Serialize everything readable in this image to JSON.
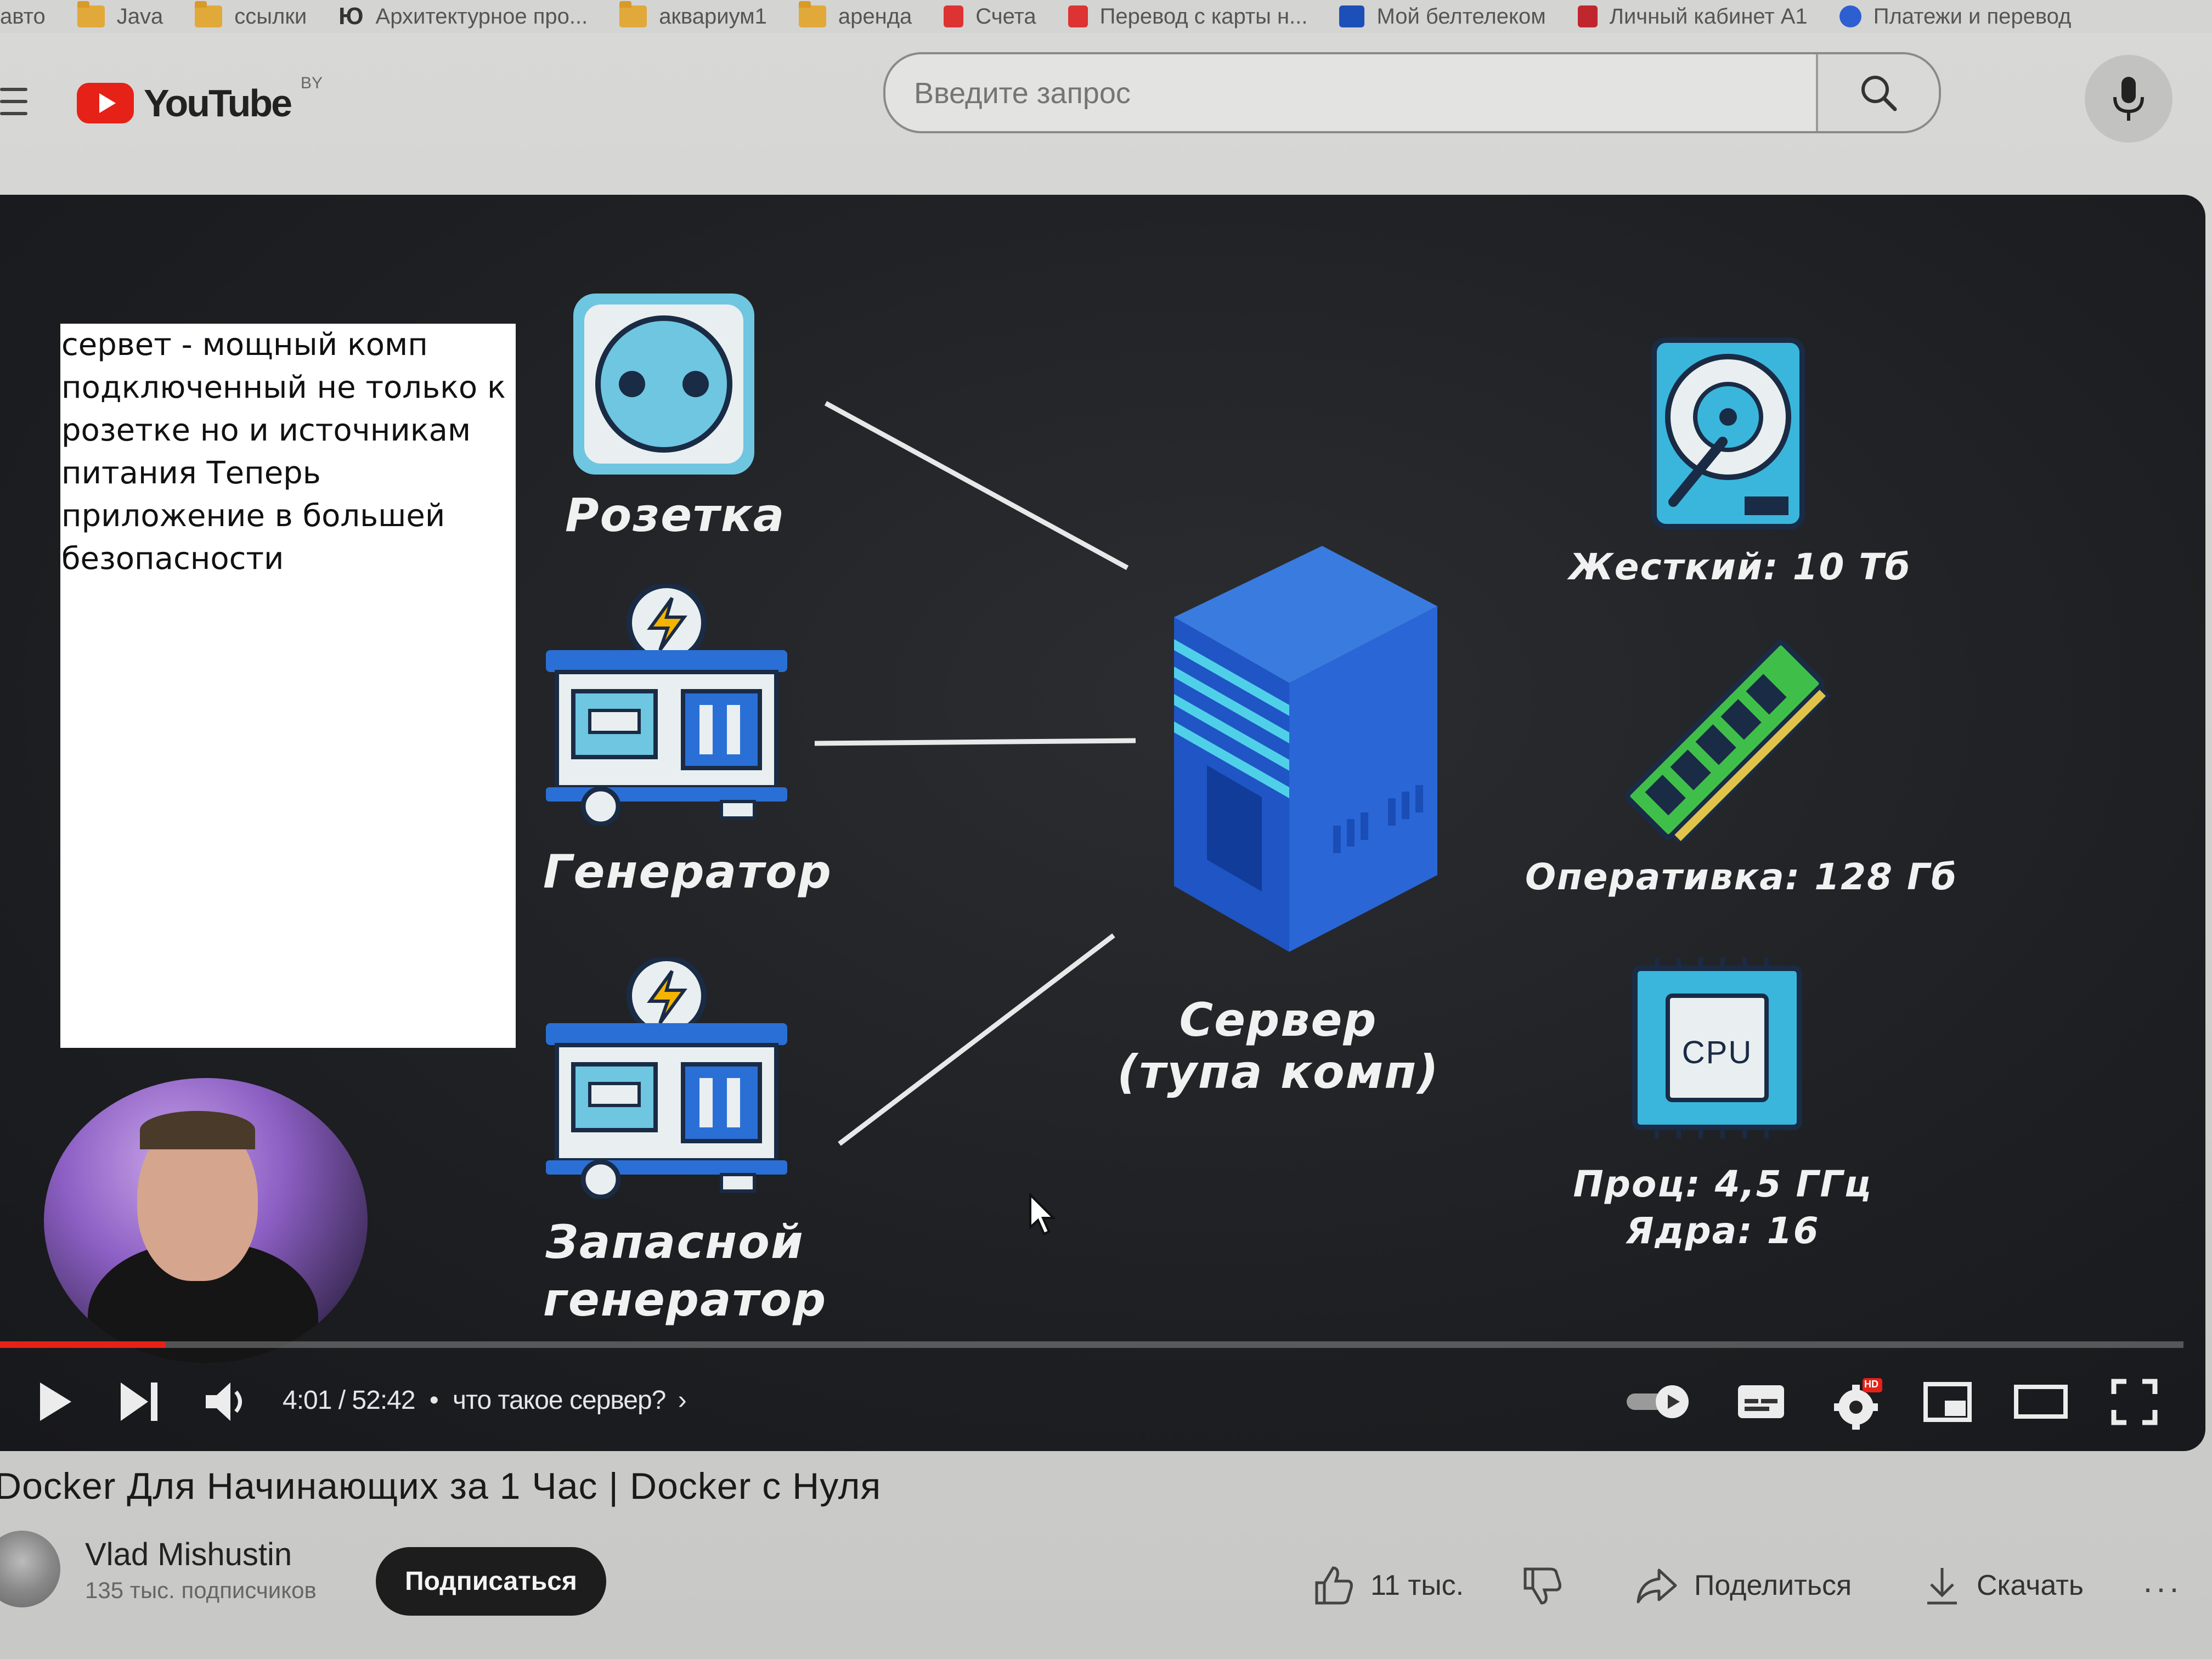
{
  "bookmarks": [
    {
      "label": "авто",
      "icon": "none"
    },
    {
      "label": "Java",
      "icon": "folder-icon"
    },
    {
      "label": "ссылки",
      "icon": "folder-icon"
    },
    {
      "label": "Архитектурное про...",
      "icon": "ю-badge-icon"
    },
    {
      "label": "аквариум1",
      "icon": "folder-icon"
    },
    {
      "label": "аренда",
      "icon": "folder-icon"
    },
    {
      "label": "Счета",
      "icon": "pdf-icon"
    },
    {
      "label": "Перевод с карты н...",
      "icon": "pdf-icon"
    },
    {
      "label": "Мой белтелеком",
      "icon": "beltelecom-icon"
    },
    {
      "label": "Личный кабинет A1",
      "icon": "a1-icon"
    },
    {
      "label": "Платежи и перевод",
      "icon": "payments-icon"
    }
  ],
  "header": {
    "logo_text": "YouTube",
    "logo_region": "BY",
    "search_placeholder": "Введите запрос"
  },
  "video": {
    "note_text": "сервет - мощный комп подключенный не только к розетке но и источникам питания Теперь приложение в большей безопасности",
    "diagram": {
      "socket_label": "Розетка",
      "generator_label": "Генератор",
      "backup_generator_label_line1": "Запасной",
      "backup_generator_label_line2": "генератор",
      "server_label_line1": "Сервер",
      "server_label_line2": "(тупа комп)",
      "hdd_label": "Жесткий: 10 Тб",
      "ram_label": "Оперативка: 128 Гб",
      "cpu_chip_text": "CPU",
      "cpu_label_line1": "Проц: 4,5 ГГц",
      "cpu_label_line2": "Ядра: 16"
    },
    "progress": 0.076,
    "time_current": "4:01",
    "time_total": "52:42",
    "time_display": "4:01 / 52:42",
    "chapter": "что такое сервер?",
    "settings_badge": "HD"
  },
  "title": "Docker Для Начинающих за 1 Час | Docker с Нуля",
  "channel": {
    "name": "Vlad Mishustin",
    "subscribers": "135 тыс. подписчиков",
    "subscribe_label": "Подписаться"
  },
  "actions": {
    "likes": "11 тыс.",
    "share_label": "Поделиться",
    "download_label": "Скачать"
  },
  "colors": {
    "accent_red": "#e62117",
    "player_bg": "#1e2023",
    "server_blue": "#2457c9"
  }
}
